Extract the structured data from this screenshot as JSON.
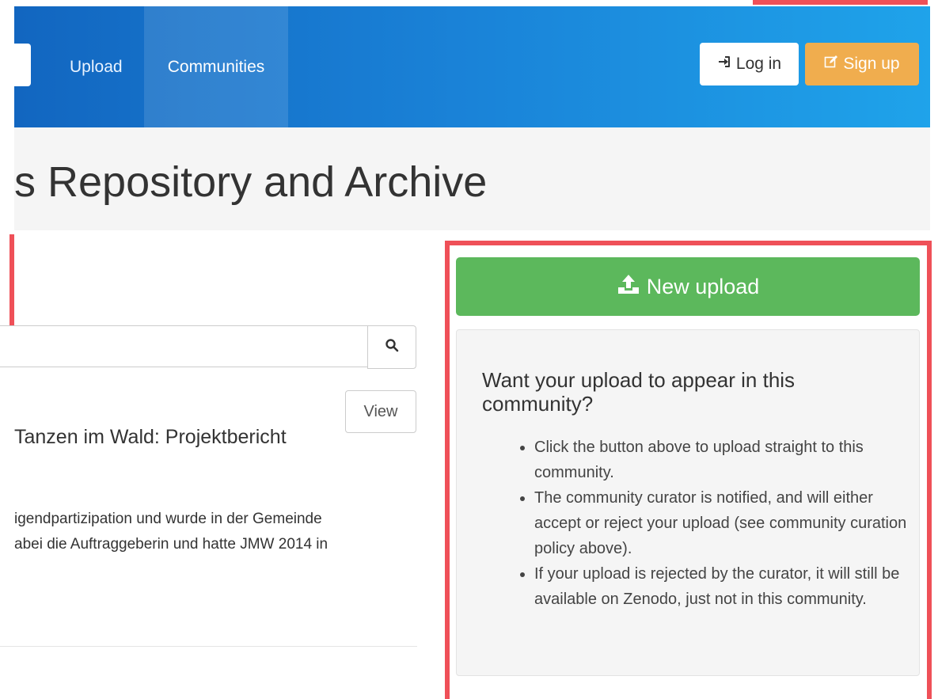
{
  "navbar": {
    "links": [
      "Upload",
      "Communities"
    ],
    "login_label": "Log in",
    "signup_label": "Sign up"
  },
  "header": {
    "title": "s Repository and Archive"
  },
  "search": {
    "button_icon": "search-icon"
  },
  "record": {
    "view_label": "View",
    "title": "Tanzen im Wald: Projektbericht",
    "description_lines": [
      "igendpartizipation und wurde in der Gemeinde",
      "abei die Auftraggeberin und hatte JMW 2014 in"
    ]
  },
  "sidebar": {
    "new_upload_label": "New upload",
    "info_title": "Want your upload to appear in this community?",
    "bullets": [
      "Click the button above to upload straight to this community.",
      "The community curator is notified, and will either accept or reject your upload (see community curation policy above).",
      "If your upload is rejected by the curator, it will still be available on Zenodo, just not in this community."
    ]
  },
  "colors": {
    "nav_start": "#1266c0",
    "nav_end": "#1fa3ea",
    "signup": "#f0ad4e",
    "new_upload": "#5cb85c",
    "highlight": "#ef5058"
  },
  "icons": [
    "sign-in-icon",
    "edit-icon",
    "search-icon",
    "upload-icon"
  ]
}
